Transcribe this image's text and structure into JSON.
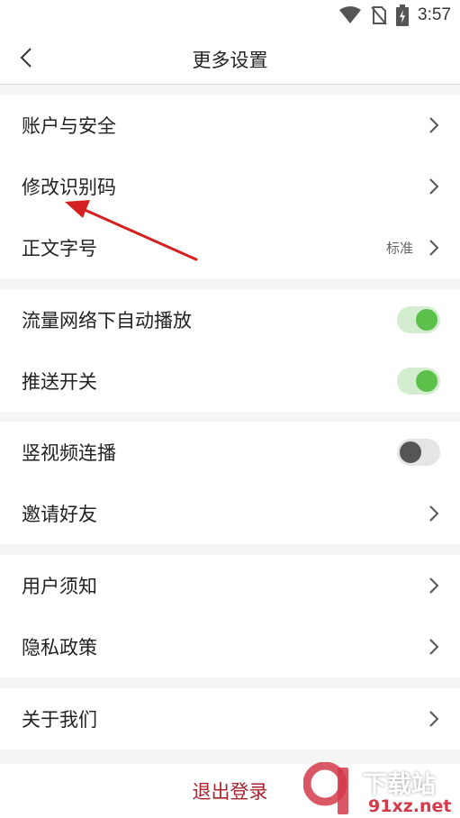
{
  "status_bar": {
    "time": "3:57",
    "icons": [
      "wifi-icon",
      "no-sim-icon",
      "battery-charging-icon"
    ]
  },
  "nav": {
    "title": "更多设置",
    "back_icon": "chevron-left-icon"
  },
  "sections": [
    {
      "rows": [
        {
          "label": "账户与安全",
          "control": "chevron"
        },
        {
          "label": "修改识别码",
          "control": "chevron"
        },
        {
          "label": "正文字号",
          "value": "标准",
          "control": "chevron"
        }
      ]
    },
    {
      "rows": [
        {
          "label": "流量网络下自动播放",
          "control": "toggle",
          "on": true
        },
        {
          "label": "推送开关",
          "control": "toggle",
          "on": true
        }
      ]
    },
    {
      "rows": [
        {
          "label": "竖视频连播",
          "control": "toggle",
          "on": false
        },
        {
          "label": "邀请好友",
          "control": "chevron"
        }
      ]
    },
    {
      "rows": [
        {
          "label": "用户须知",
          "control": "chevron"
        },
        {
          "label": "隐私政策",
          "control": "chevron"
        }
      ]
    },
    {
      "rows": [
        {
          "label": "关于我们",
          "control": "chevron"
        }
      ]
    }
  ],
  "logout": {
    "label": "退出登录"
  },
  "watermark": {
    "top_text": "下载站",
    "bottom_text": "91xz.net",
    "logo_text": "91"
  },
  "colors": {
    "accent_red": "#a8242c",
    "toggle_on": "#5cc14b",
    "toggle_on_track": "#d4ecd0",
    "toggle_off_knob": "#555555",
    "annotation_arrow": "#d42020",
    "background": "#f5f5f5"
  }
}
